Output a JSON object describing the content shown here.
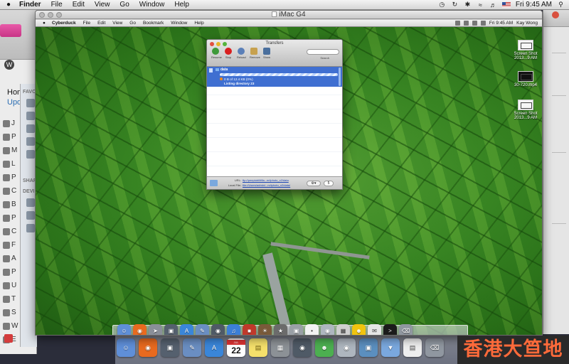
{
  "host_menubar": {
    "app": "Finder",
    "menus": [
      "File",
      "Edit",
      "View",
      "Go",
      "Window",
      "Help"
    ],
    "clock": "Fri 9:45 AM",
    "tray_icons": [
      "time-machine-icon",
      "sync-icon",
      "bluetooth-icon",
      "wifi-icon",
      "volume-icon",
      "us-flag-icon",
      "spotlight-icon"
    ]
  },
  "background_app": {
    "home_label": "Hom",
    "update_label": "Upd",
    "favorites_label": "FAVO",
    "shared_label": "SHAR",
    "devices_label": "DEVI",
    "sidebar_letters": [
      "J",
      "P",
      "M",
      "L",
      "P",
      "C",
      "B",
      "P",
      "C",
      "F",
      "A",
      "P",
      "U",
      "T",
      "S",
      "W",
      "E"
    ]
  },
  "vnc_window": {
    "title": "iMac G4"
  },
  "remote_menubar": {
    "app": "Cyberduck",
    "menus": [
      "File",
      "Edit",
      "View",
      "Go",
      "Bookmark",
      "Window",
      "Help"
    ],
    "clock": "Fri 9:45 AM",
    "user": "Kay Wong"
  },
  "remote_desktop_icons": [
    {
      "label": "Screen Shot 2013...9 AM",
      "style": "light"
    },
    {
      "label": "30-720.mp4",
      "style": "dark"
    },
    {
      "label": "Screen Shot 2013...9 AM",
      "style": "light"
    }
  ],
  "transfers": {
    "title": "Transfers",
    "toolbar": {
      "resume": "Resume",
      "stop": "Stop",
      "reload": "Reload",
      "remove": "Remove",
      "show": "Show",
      "search_label": "Search"
    },
    "items": [
      {
        "name": "data",
        "progress_fraction": 0.02,
        "status": "0 B of 12.4 KB (0%)",
        "activity": "Listing directory 23"
      }
    ],
    "footer": {
      "url_label": "URL:",
      "url_value": "ftp://peeptubiMfla...m/iphoto_x2/data",
      "local_label": "Local File:",
      "local_value": "file://Users/admin/...m/iphoto_x2/data/",
      "stepper_value": "5"
    }
  },
  "remote_dock_icons": [
    "finder-icon",
    "firefox-icon",
    "launchpad-icon",
    "photo-icon",
    "app-store-icon",
    "preview-icon",
    "facetime-icon",
    "itunes-icon",
    "photo-booth-icon",
    "iphoto-icon",
    "imovie-icon",
    "image-capture-icon",
    "ichat-icon",
    "webcam-icon",
    "calculator-icon",
    "cyberduck-icon",
    "mail-icon",
    "terminal-icon",
    "trash-icon"
  ],
  "host_dock_icons": [
    "finder-icon",
    "firefox-icon",
    "photo-icon",
    "preview-icon",
    "app-store-icon",
    "calendar-icon",
    "stickies-icon",
    "remote-desktop-icon",
    "facetime-icon",
    "adium-icon",
    "webcam-icon",
    "screen-share-icon",
    "downloads-folder-icon",
    "documents-icon",
    "trash-icon"
  ],
  "host_dock": {
    "calendar_month": "JUL",
    "calendar_day": "22"
  },
  "watermark": "香港大笪地"
}
